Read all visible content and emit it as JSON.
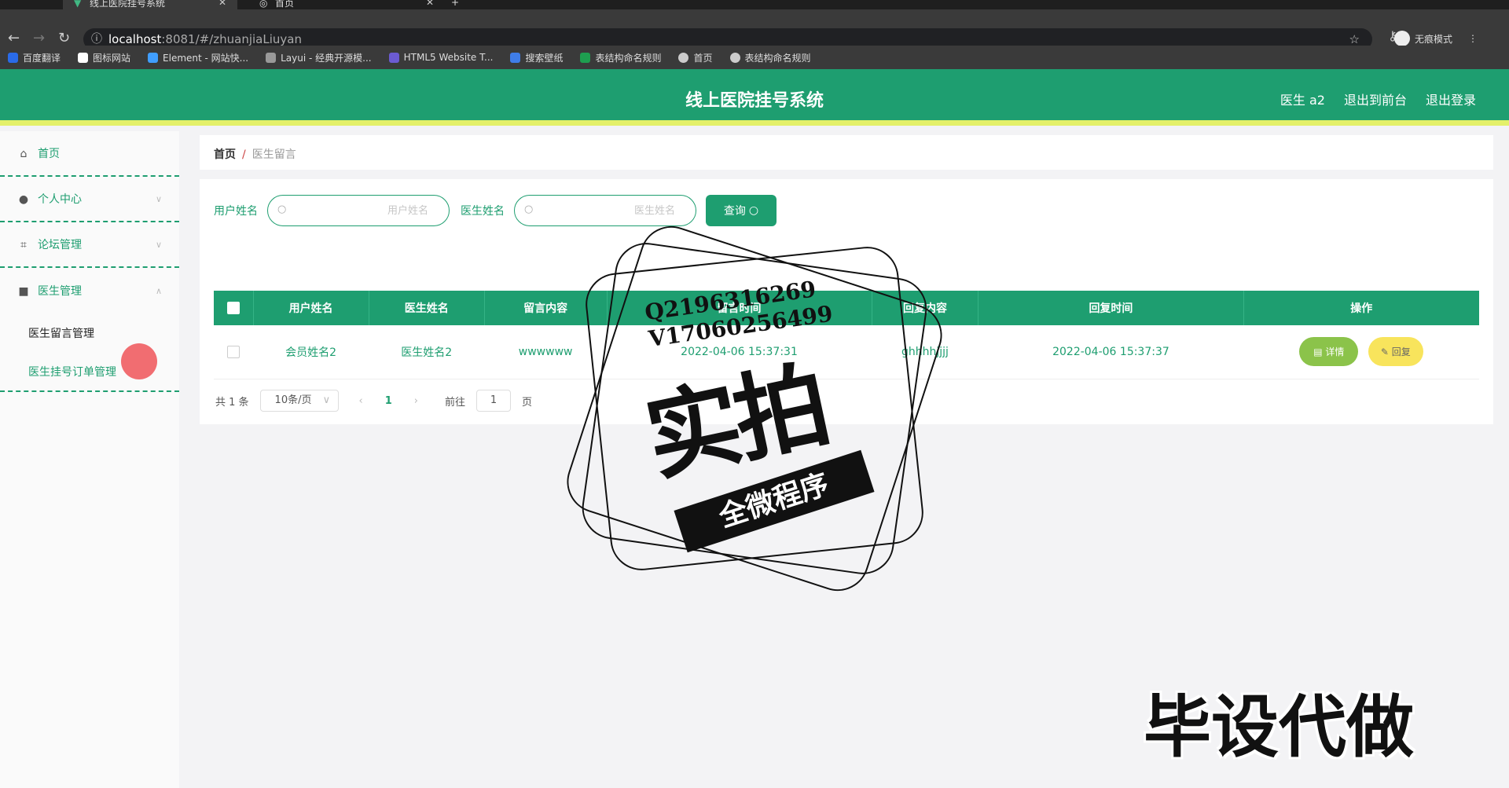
{
  "browser": {
    "tabs": [
      {
        "label": "线上医院挂号系统"
      },
      {
        "label": "首页"
      }
    ],
    "url_host": "localhost",
    "url_path": ":8081/#/zhuanjiaLiuyan",
    "incognito_label": "无痕模式",
    "bookmarks": [
      {
        "label": "百度翻译",
        "color": "#2a6be8"
      },
      {
        "label": "图标网站",
        "color": "#ffffff"
      },
      {
        "label": "Element - 网站快...",
        "color": "#409eff"
      },
      {
        "label": "Layui - 经典开源模...",
        "color": "#999999"
      },
      {
        "label": "HTML5 Website T...",
        "color": "#6b5bd2"
      },
      {
        "label": "搜索壁纸",
        "color": "#3f7de8"
      },
      {
        "label": "表结构命名规则",
        "color": "#1e9e50"
      },
      {
        "label": "首页",
        "color": "#cccccc"
      },
      {
        "label": "表结构命名规则",
        "color": "#cccccc"
      }
    ]
  },
  "header": {
    "title": "线上医院挂号系统",
    "user": "医生 a2",
    "back_front": "退出到前台",
    "logout": "退出登录",
    "accent": "#1e9e70"
  },
  "sidebar": {
    "home": "首页",
    "personal": "个人中心",
    "forum": "论坛管理",
    "doctor": "医生管理",
    "sub1": "医生留言管理",
    "sub2": "医生挂号订单管理"
  },
  "breadcrumb": {
    "home": "首页",
    "sep": "/",
    "current": "医生留言"
  },
  "search": {
    "user_label": "用户姓名",
    "user_placeholder": "用户姓名",
    "doctor_label": "医生姓名",
    "doctor_placeholder": "医生姓名",
    "query": "查询"
  },
  "table": {
    "headers": [
      "用户姓名",
      "医生姓名",
      "留言内容",
      "留言时间",
      "回复内容",
      "回复时间",
      "操作"
    ],
    "rows": [
      {
        "user": "会员姓名2",
        "doctor": "医生姓名2",
        "content": "wwwwww",
        "time": "2022-04-06 15:37:31",
        "reply": "ghhhhjjjj",
        "reply_time": "2022-04-06 15:37:37"
      }
    ],
    "detail": "详情",
    "reply_btn": "回复"
  },
  "pager": {
    "total": "共 1 条",
    "size": "10条/页",
    "page": "1",
    "goto": "前往",
    "goto_val": "1",
    "unit": "页"
  },
  "watermark": {
    "qq": "Q2196316269",
    "vx": "V17060256499",
    "big": "实拍",
    "ribbon": "全微程序",
    "corner": "毕设代做"
  }
}
